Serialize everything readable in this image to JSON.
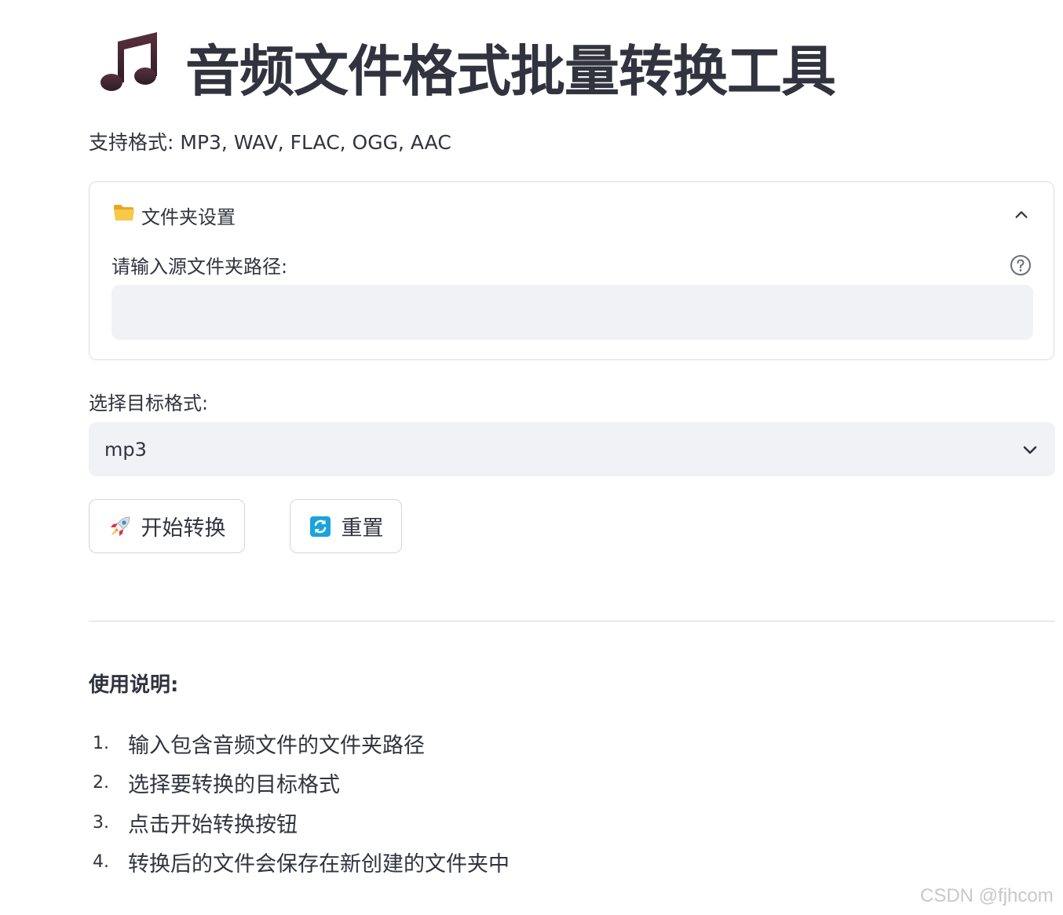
{
  "title": "音频文件格式批量转换工具",
  "title_icon": "music-notes-icon",
  "subtitle": "支持格式: MP3, WAV, FLAC, OGG, AAC",
  "folder_settings": {
    "header_label": "文件夹设置",
    "header_icon": "folder-icon",
    "expanded": true,
    "source_label": "请输入源文件夹路径:",
    "source_value": "",
    "help_icon": "question-circle-icon"
  },
  "target_format": {
    "label": "选择目标格式:",
    "selected": "mp3"
  },
  "buttons": {
    "start_label": "开始转换",
    "start_icon": "rocket-icon",
    "reset_label": "重置",
    "reset_icon": "refresh-icon"
  },
  "instructions": {
    "title": "使用说明:",
    "steps": [
      {
        "num": "1.",
        "text": "输入包含音频文件的文件夹路径"
      },
      {
        "num": "2.",
        "text": "选择要转换的目标格式"
      },
      {
        "num": "3.",
        "text": "点击开始转换按钮"
      },
      {
        "num": "4.",
        "text": "转换后的文件会保存在新创建的文件夹中"
      }
    ]
  },
  "watermark": "CSDN @fjhcom",
  "colors": {
    "text": "#31333f",
    "input_bg": "#f0f2f6",
    "border": "#dcdde2",
    "icon_dark": "#4a2a36",
    "folder": "#f7c948",
    "reset_icon": "#1aa3dc"
  }
}
